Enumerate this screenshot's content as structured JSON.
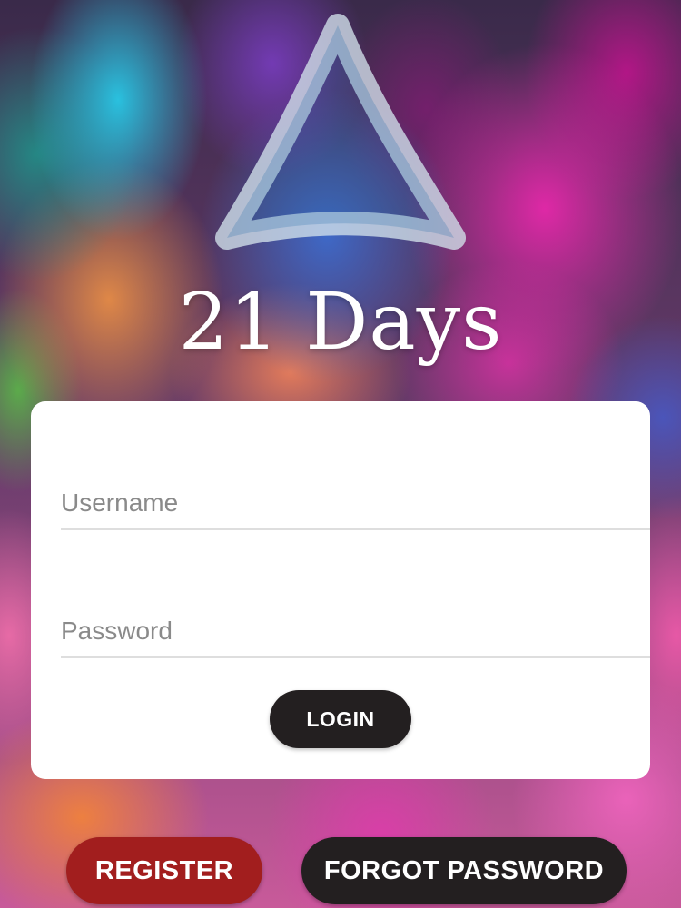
{
  "app": {
    "logo_text": "21 Days",
    "logo_icon": "triangle-logo-icon"
  },
  "login_form": {
    "username": {
      "placeholder": "Username",
      "value": ""
    },
    "password": {
      "placeholder": "Password",
      "value": ""
    },
    "login_label": "LOGIN"
  },
  "footer": {
    "register_label": "REGISTER",
    "forgot_password_label": "FORGOT PASSWORD"
  },
  "colors": {
    "card_background": "#ffffff",
    "login_button": "#231f20",
    "register_button": "#a21e1e",
    "forgot_button": "#231f20"
  }
}
